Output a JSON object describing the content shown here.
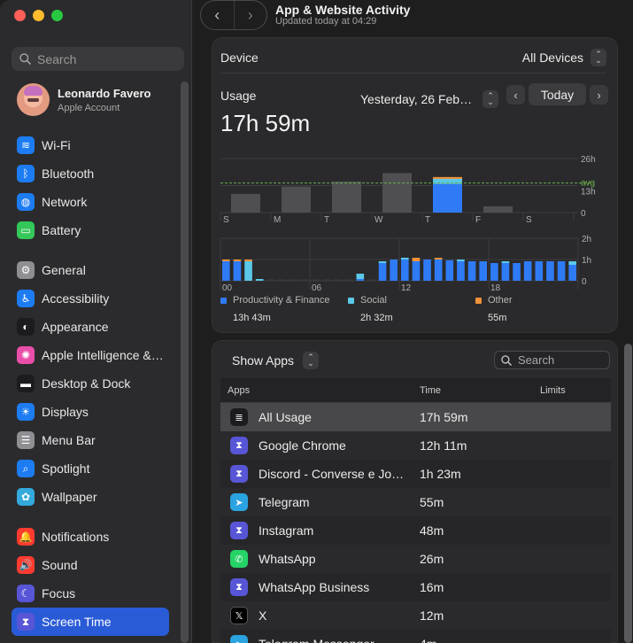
{
  "sidebar": {
    "search_placeholder": "Search",
    "account": {
      "name": "Leonardo Favero",
      "subtitle": "Apple Account"
    },
    "groups": [
      [
        {
          "label": "Wi-Fi",
          "icon": "wifi-icon",
          "color": "#1d7cf2"
        },
        {
          "label": "Bluetooth",
          "icon": "bluetooth-icon",
          "color": "#1d7cf2"
        },
        {
          "label": "Network",
          "icon": "globe-icon",
          "color": "#1d7cf2"
        },
        {
          "label": "Battery",
          "icon": "battery-icon",
          "color": "#34c759"
        }
      ],
      [
        {
          "label": "General",
          "icon": "gear-icon",
          "color": "#8e8e93"
        },
        {
          "label": "Accessibility",
          "icon": "accessibility-icon",
          "color": "#1d7cf2"
        },
        {
          "label": "Appearance",
          "icon": "appearance-icon",
          "color": "#1c1c1e"
        },
        {
          "label": "Apple Intelligence &…",
          "icon": "apple-intelligence-icon",
          "color": "#e94ea9"
        },
        {
          "label": "Desktop & Dock",
          "icon": "dock-icon",
          "color": "#1c1c1e"
        },
        {
          "label": "Displays",
          "icon": "sun-icon",
          "color": "#1d7cf2"
        },
        {
          "label": "Menu Bar",
          "icon": "menu-bar-icon",
          "color": "#8e8e93"
        },
        {
          "label": "Spotlight",
          "icon": "magnifier-icon",
          "color": "#1d7cf2"
        },
        {
          "label": "Wallpaper",
          "icon": "flower-icon",
          "color": "#34aadc"
        }
      ],
      [
        {
          "label": "Notifications",
          "icon": "bell-icon",
          "color": "#ff3b30"
        },
        {
          "label": "Sound",
          "icon": "speaker-icon",
          "color": "#ff3b30"
        },
        {
          "label": "Focus",
          "icon": "moon-icon",
          "color": "#5856d6"
        },
        {
          "label": "Screen Time",
          "icon": "hourglass-icon",
          "color": "#5856d6",
          "active": true
        }
      ]
    ]
  },
  "header": {
    "title": "App & Website Activity",
    "subtitle": "Updated today at 04:29"
  },
  "device": {
    "label": "Device",
    "value": "All Devices"
  },
  "usage": {
    "label": "Usage",
    "total": "17h 59m",
    "date": "Yesterday, 26 Feb…",
    "today_button": "Today"
  },
  "colors": {
    "productivity": "#2f7bf5",
    "social": "#5bc8e8",
    "other": "#f0923a",
    "bar_gray": "#4f4f51",
    "avg_line": "#6ab04c"
  },
  "chart_data": [
    {
      "type": "bar",
      "categories": [
        "S",
        "M",
        "T",
        "W",
        "T",
        "F",
        "S"
      ],
      "series": [
        {
          "values": [
            9,
            12.5,
            15,
            19,
            0,
            3,
            0
          ]
        },
        {
          "values": [
            0,
            0,
            0,
            0,
            13.7,
            0,
            0
          ]
        },
        {
          "values": [
            0,
            0,
            0,
            0,
            2.5,
            0,
            0
          ]
        },
        {
          "values": [
            0,
            0,
            0,
            0,
            0.9,
            0,
            0
          ]
        }
      ],
      "highlight_index": 4,
      "average": 14.2,
      "average_label": "avg",
      "yticks": [
        "26h",
        "13h",
        "0"
      ],
      "ylim": [
        0,
        26
      ]
    },
    {
      "type": "bar",
      "xticks": [
        "00",
        "06",
        "12",
        "18"
      ],
      "yticks": [
        "2h",
        "1h",
        "0"
      ],
      "ylim": [
        0,
        120
      ],
      "series": [
        {
          "name": "Productivity & Finance",
          "values": [
            55,
            55,
            0,
            0,
            0,
            0,
            0,
            0,
            0,
            0,
            0,
            0,
            5,
            0,
            50,
            60,
            60,
            55,
            60,
            60,
            58,
            55,
            55,
            55,
            50,
            50,
            50,
            55,
            55,
            55,
            55,
            45
          ]
        },
        {
          "name": "Social",
          "values": [
            0,
            0,
            55,
            5,
            0,
            0,
            0,
            0,
            0,
            0,
            0,
            0,
            15,
            0,
            5,
            0,
            5,
            0,
            0,
            0,
            0,
            5,
            0,
            0,
            0,
            5,
            0,
            0,
            0,
            0,
            0,
            10
          ]
        },
        {
          "name": "Other",
          "values": [
            5,
            5,
            5,
            0,
            0,
            0,
            0,
            0,
            0,
            0,
            0,
            0,
            0,
            0,
            0,
            0,
            0,
            10,
            0,
            5,
            0,
            0,
            0,
            0,
            0,
            0,
            0,
            0,
            0,
            0,
            0,
            0
          ]
        }
      ],
      "legend": [
        {
          "name": "Productivity & Finance",
          "value": "13h 43m"
        },
        {
          "name": "Social",
          "value": "2h 32m"
        },
        {
          "name": "Other",
          "value": "55m"
        }
      ]
    }
  ],
  "apps": {
    "show_label": "Show Apps",
    "search_placeholder": "Search",
    "columns": {
      "app": "Apps",
      "time": "Time",
      "limits": "Limits"
    },
    "rows": [
      {
        "name": "All Usage",
        "time": "17h 59m",
        "icon": "stack-icon",
        "color": "#1c1c1e",
        "selected": true
      },
      {
        "name": "Google Chrome",
        "time": "12h 11m",
        "icon": "hourglass-icon",
        "color": "#5856d6"
      },
      {
        "name": "Discord - Converse e Jo…",
        "time": "1h 23m",
        "icon": "hourglass-icon",
        "color": "#5856d6"
      },
      {
        "name": "Telegram",
        "time": "55m",
        "icon": "telegram-icon",
        "color": "#2aa3e0"
      },
      {
        "name": "Instagram",
        "time": "48m",
        "icon": "hourglass-icon",
        "color": "#5856d6"
      },
      {
        "name": "WhatsApp",
        "time": "26m",
        "icon": "whatsapp-icon",
        "color": "#25d366"
      },
      {
        "name": "WhatsApp Business",
        "time": "16m",
        "icon": "hourglass-icon",
        "color": "#5856d6"
      },
      {
        "name": "X",
        "time": "12m",
        "icon": "x-icon",
        "color": "#000000"
      },
      {
        "name": "Telegram Messenger",
        "time": "4m",
        "icon": "telegram-icon",
        "color": "#2aa3e0"
      }
    ]
  }
}
